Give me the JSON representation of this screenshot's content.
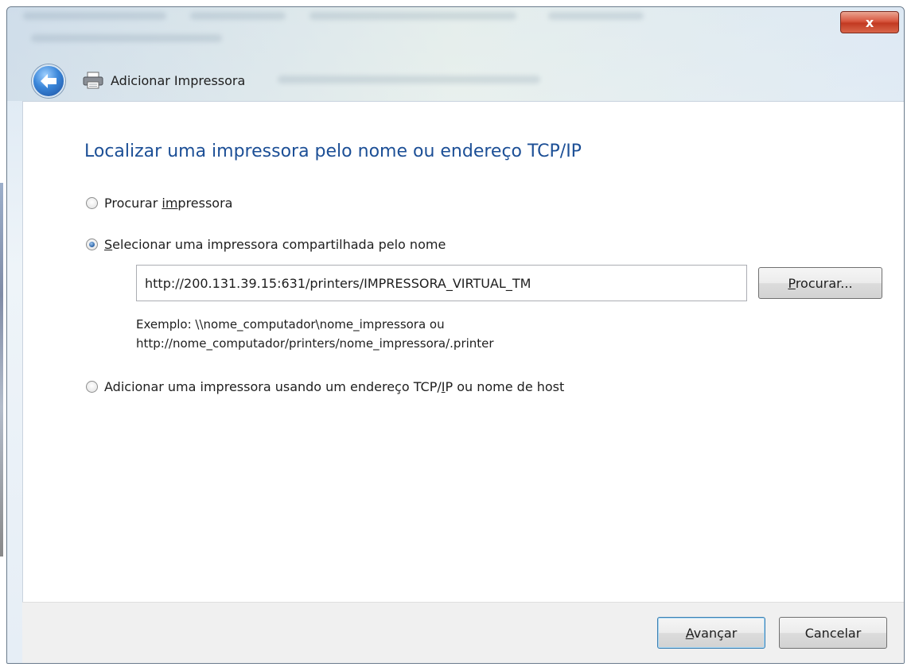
{
  "window": {
    "close_label": "x"
  },
  "header": {
    "title": "Adicionar Impressora"
  },
  "main": {
    "heading": "Localizar uma impressora pelo nome ou endereço TCP/IP",
    "options": [
      {
        "label_pre": "Procurar ",
        "label_u": "im",
        "label_post": "pressora",
        "checked": false
      },
      {
        "label_pre": "",
        "label_u": "S",
        "label_post": "elecionar uma impressora compartilhada pelo nome",
        "checked": true
      },
      {
        "label_pre": "Adicionar uma impressora usando um endereço TCP/",
        "label_u": "I",
        "label_post": "P ou nome de host",
        "checked": false
      }
    ],
    "shared_name_value": "http://200.131.39.15:631/printers/IMPRESSORA_VIRTUAL_TM",
    "browse_button": {
      "label_u": "P",
      "label_post": "rocurar..."
    },
    "example_line1": "Exemplo: \\\\nome_computador\\nome_impressora ou",
    "example_line2": "http://nome_computador/printers/nome_impressora/.printer"
  },
  "footer": {
    "next_button": {
      "label_u": "A",
      "label_post": "vançar"
    },
    "cancel_label": "Cancelar"
  },
  "colors": {
    "heading": "#1c4f96",
    "close_button": "#c23a22",
    "footer_bg": "#f0f0f0"
  },
  "icons": {
    "back": "back-arrow-icon",
    "printer": "printer-icon",
    "close": "close-icon"
  }
}
